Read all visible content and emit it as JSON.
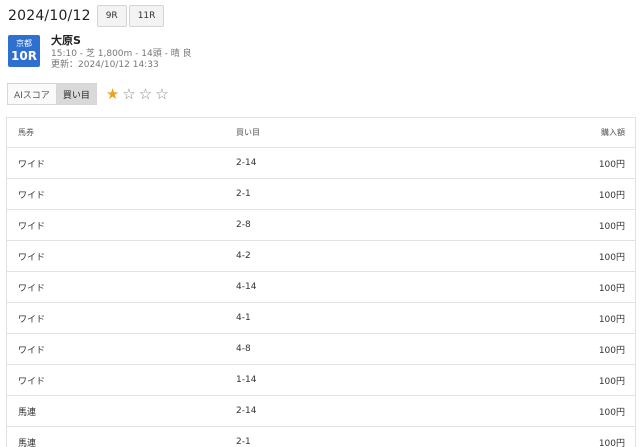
{
  "header": {
    "date": "2024/10/12",
    "prev_race": "9R",
    "next_race": "11R"
  },
  "race": {
    "venue": "京都",
    "number": "10R",
    "name": "大原S",
    "detail": "15:10 - 芝 1,800m - 14頭 - 晴 良",
    "updated": "更新：2024/10/12 14:33",
    "badge_color": "#2f6fcf"
  },
  "tabs": [
    {
      "label": "AIスコア",
      "active": false
    },
    {
      "label": "買い目",
      "active": true
    }
  ],
  "rating": {
    "value": 1,
    "max": 4,
    "star_color": "#f0a020"
  },
  "table": {
    "headers": [
      "馬券",
      "買い目",
      "購入額"
    ],
    "rows": [
      [
        "ワイド",
        "2-14",
        "100円"
      ],
      [
        "ワイド",
        "2-1",
        "100円"
      ],
      [
        "ワイド",
        "2-8",
        "100円"
      ],
      [
        "ワイド",
        "4-2",
        "100円"
      ],
      [
        "ワイド",
        "4-14",
        "100円"
      ],
      [
        "ワイド",
        "4-1",
        "100円"
      ],
      [
        "ワイド",
        "4-8",
        "100円"
      ],
      [
        "ワイド",
        "1-14",
        "100円"
      ],
      [
        "馬連",
        "2-14",
        "100円"
      ],
      [
        "馬連",
        "2-1",
        "100円"
      ]
    ]
  }
}
